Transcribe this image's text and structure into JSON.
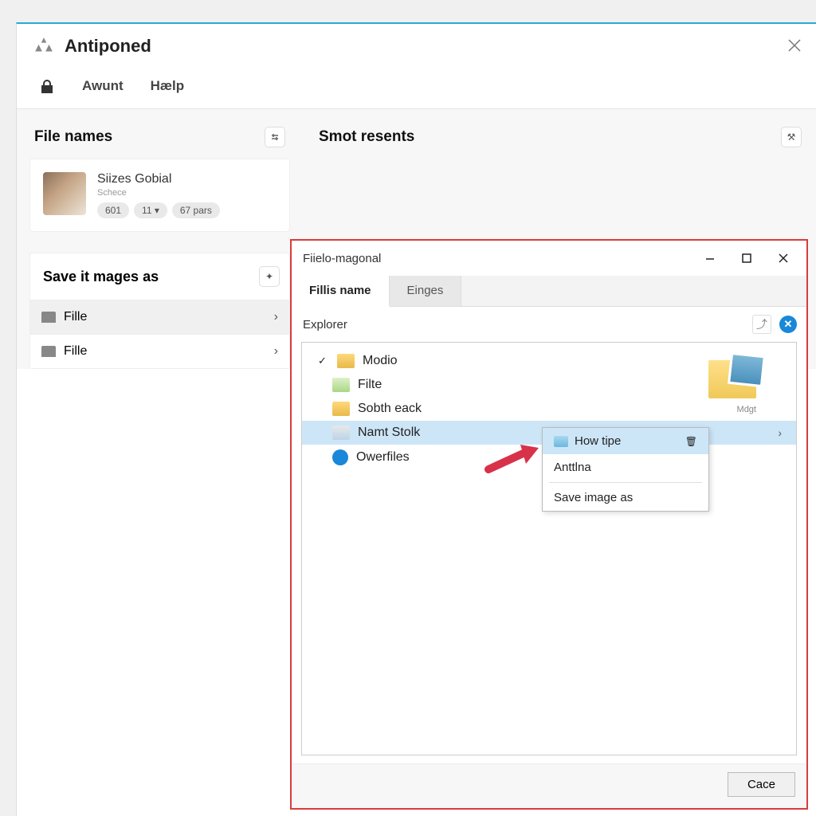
{
  "main": {
    "title": "Antiponed",
    "toolbar": {
      "account": "Awunt",
      "help": "Hælp"
    }
  },
  "left": {
    "section_title": "File names",
    "profile": {
      "name": "Siizes Gobial",
      "sub": "Schece",
      "pills": [
        "601",
        "11 ▾",
        "67 pars"
      ]
    },
    "save_title": "Save it mages as",
    "save_items": [
      "Fille",
      "Fille"
    ]
  },
  "right": {
    "section_title": "Smot resents"
  },
  "dialog": {
    "title": "Fiielo-magonal",
    "tabs": [
      "Fillis name",
      "Einges"
    ],
    "explorer_label": "Explorer",
    "tree": [
      {
        "label": "Modio",
        "icon": "folder",
        "check": true
      },
      {
        "label": "Filte",
        "icon": "lib"
      },
      {
        "label": "Sobth eack",
        "icon": "folder"
      },
      {
        "label": "Namt Stolk",
        "icon": "doc",
        "selected": true,
        "expandable": true
      },
      {
        "label": "Owerfiles",
        "icon": "blue"
      }
    ],
    "big_folder_label": "Mdgt",
    "footer_btn": "Cace"
  },
  "context_menu": {
    "items": [
      {
        "label": "How tipe",
        "icon": true,
        "highlighted": true,
        "trash": true
      },
      {
        "label": "Anttlna"
      },
      {
        "sep": true
      },
      {
        "label": "Save image as"
      }
    ]
  }
}
